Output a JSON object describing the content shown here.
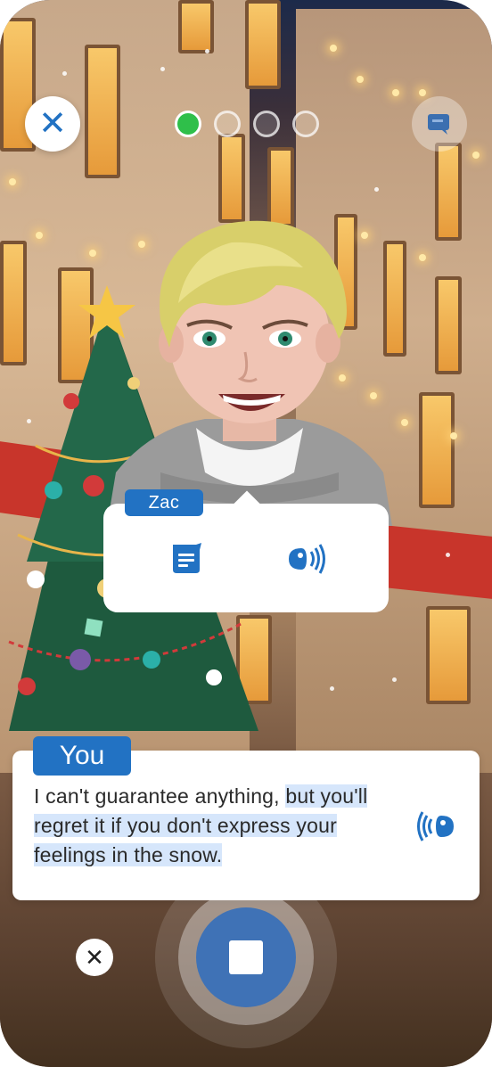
{
  "progress": {
    "total": 4,
    "current": 1
  },
  "partner": {
    "name": "Zac"
  },
  "user": {
    "label": "You",
    "transcript_part1": "I can't guarantee anything, ",
    "transcript_part2": "but you'll regret it if you don't express your feelings in the snow."
  },
  "icons": {
    "close": "close-icon",
    "captions": "caption-icon",
    "text": "text-bubble-icon",
    "audio": "speaker-icon",
    "stop": "stop-icon",
    "cancel": "close-icon"
  },
  "colors": {
    "accent": "#2272c3",
    "progress_active": "#2fbf4a",
    "stop_button": "#3f72b6",
    "highlight": "#d6e6fb"
  }
}
